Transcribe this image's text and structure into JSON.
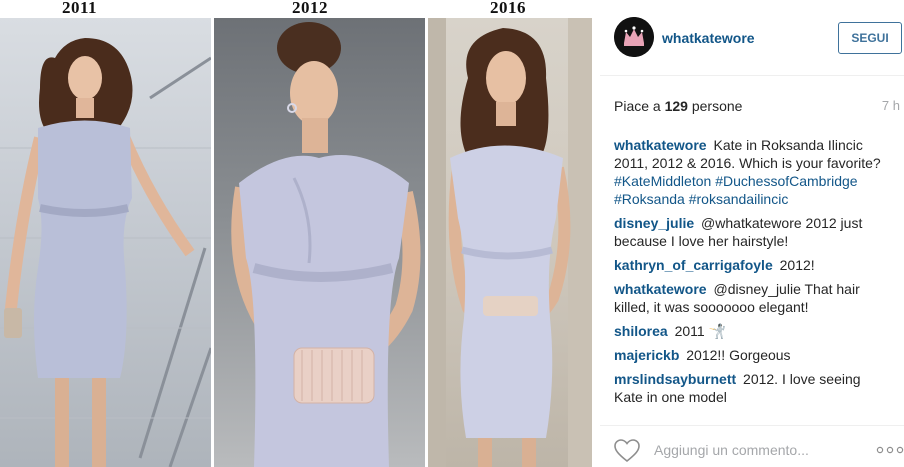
{
  "photo": {
    "years": [
      "2011",
      "2012",
      "2016"
    ]
  },
  "header": {
    "username": "whatkatewore",
    "follow_label": "SEGUI"
  },
  "stats": {
    "likes_prefix": "Piace a ",
    "likes_count": "129",
    "likes_suffix": " persone",
    "time": "7 h"
  },
  "comments": [
    {
      "user": "whatkatewore",
      "text": "Kate in Roksanda Ilincic 2011, 2012 & 2016. Which is your favorite?",
      "tags": [
        "#KateMiddleton",
        "#DuchessofCambridge",
        "#Roksanda",
        "#roksandailincic"
      ]
    },
    {
      "user": "disney_julie",
      "text": "@whatkatewore 2012 just because I love her hairstyle!"
    },
    {
      "user": "kathryn_of_carrigafoyle",
      "text": "2012!"
    },
    {
      "user": "whatkatewore",
      "text": "@disney_julie That hair killed, it was sooooooo elegant!"
    },
    {
      "user": "shilorea",
      "text": "2011 🤺"
    },
    {
      "user": "majerickb",
      "text": "2012!! Gorgeous"
    },
    {
      "user": "mrslindsayburnett",
      "text": "2012. I love seeing Kate in one model"
    }
  ],
  "footer": {
    "comment_placeholder": "Aggiungi un commento..."
  },
  "icons": {
    "like": "heart-icon",
    "more": "more-options-icon",
    "avatar": "crown-logo-icon"
  },
  "colors": {
    "link": "#125688",
    "button": "#3f729b",
    "muted": "#a5a7aa"
  }
}
